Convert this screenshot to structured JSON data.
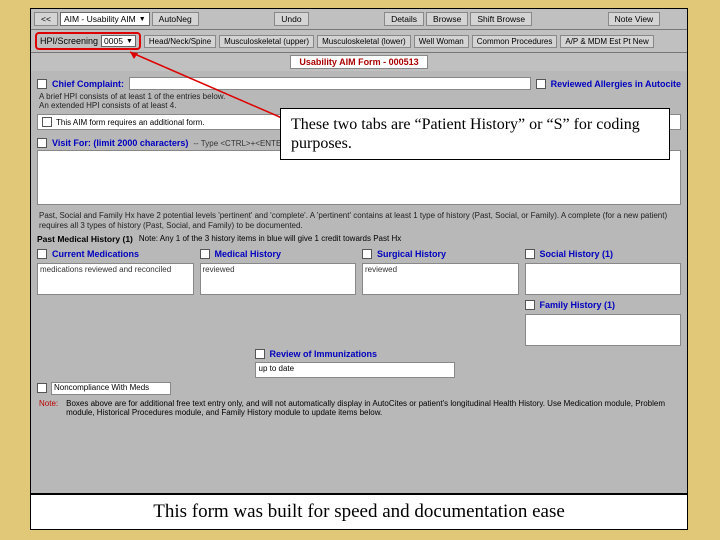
{
  "topbar": {
    "nav_prev": "<<",
    "dropdown": "AIM - Usability AIM",
    "autoneg": "AutoNeg",
    "undo": "Undo",
    "details": "Details",
    "browse": "Browse",
    "shift_browse": "Shift Browse",
    "note_view": "Note View"
  },
  "tabs": {
    "hpi_label": "HPI/Screening",
    "hpi_value": "0005",
    "items": [
      "Head/Neck/Spine",
      "Musculoskeletal (upper)",
      "Musculoskeletal (lower)",
      "Well Woman",
      "Common Procedures",
      "A/P & MDM Est Pt New"
    ]
  },
  "form": {
    "title": "Usability AIM Form - 000513",
    "chief_label": "Chief Complaint:",
    "reviewed_allergies": "Reviewed Allergies in Autocite",
    "hpi_desc1": "A brief HPI consists of at least 1 of the entries below.",
    "hpi_desc2": "An extended HPI consists of at least 4.",
    "additional_form_note": "This AIM form requires an additional form.",
    "visit_for_label": "Visit For: (limit 2000 characters)",
    "visit_for_hint": "-- Type <CTRL>+<ENTER> for new line --",
    "psf_desc": "Past, Social and Family Hx have 2 potential levels 'pertinent' and 'complete'. A 'pertinent' contains at least 1 type of history (Past, Social, or Family). A complete (for a new patient) requires all 3 types of history (Past, Social, and Family) to be documented.",
    "pmh_label": "Past Medical History (1)",
    "pmh_note": "Note: Any 1 of the 3 history items in blue will give 1 credit towards Past Hx",
    "cols": {
      "cur_meds": "Current Medications",
      "cur_meds_text": "medications reviewed and reconciled",
      "med_hist": "Medical History",
      "med_hist_text": "reviewed",
      "surg_hist": "Surgical History",
      "surg_hist_text": "reviewed",
      "social_hist": "Social History (1)",
      "family_hist": "Family History (1)"
    },
    "review_imm": "Review of Immunizations",
    "review_imm_text": "up to date",
    "noncomp_label": "Noncompliance With Meds",
    "footer_lbl": "Note:",
    "footer_text": "Boxes above are for additional free text entry only, and will not automatically display in AutoCites or patient's longitudinal Health History. Use Medication module, Problem module, Historical Procedures module, and Family History module to update items below."
  },
  "callouts": {
    "top": "These two tabs are “Patient History” or “S” for coding purposes.",
    "bottom": "This form was built for speed and documentation ease"
  }
}
